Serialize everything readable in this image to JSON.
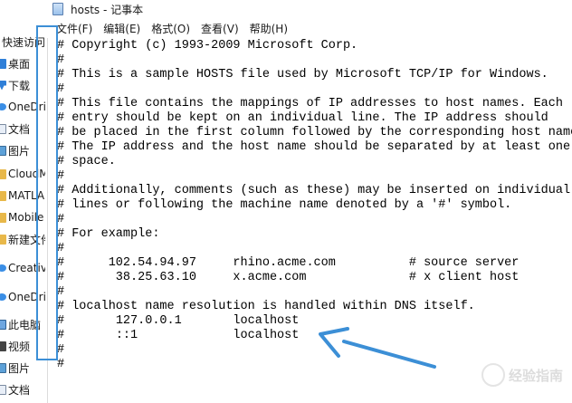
{
  "window": {
    "title": "hosts - 记事本"
  },
  "menu": [
    {
      "label": "文件(F)"
    },
    {
      "label": "编辑(E)"
    },
    {
      "label": "格式(O)"
    },
    {
      "label": "查看(V)"
    },
    {
      "label": "帮助(H)"
    }
  ],
  "sidebar": {
    "header": "快速访问",
    "items": [
      {
        "label": "桌面",
        "icon": "desktop-icon"
      },
      {
        "label": "下载",
        "icon": "download-icon"
      },
      {
        "label": "OneDrive",
        "icon": "cloud-icon"
      },
      {
        "label": "文档",
        "icon": "document-icon"
      },
      {
        "label": "图片",
        "icon": "picture-icon"
      },
      {
        "label": "CloudM",
        "icon": "folder-icon"
      },
      {
        "label": "MATLAB",
        "icon": "folder-icon"
      },
      {
        "label": "Mobile",
        "icon": "folder-icon"
      },
      {
        "label": "新建文件夹",
        "icon": "folder-icon"
      },
      {
        "label": "Creative Cloud",
        "icon": "cloud-icon"
      },
      {
        "label": "OneDrive",
        "icon": "cloud-icon"
      },
      {
        "label": "此电脑",
        "icon": "pc-icon"
      },
      {
        "label": "视频",
        "icon": "video-icon"
      },
      {
        "label": "图片",
        "icon": "picture-icon"
      },
      {
        "label": "文档",
        "icon": "document-icon"
      }
    ]
  },
  "editor": {
    "lines": [
      "# Copyright (c) 1993-2009 Microsoft Corp.",
      "#",
      "# This is a sample HOSTS file used by Microsoft TCP/IP for Windows.",
      "#",
      "# This file contains the mappings of IP addresses to host names. Each",
      "# entry should be kept on an individual line. The IP address should",
      "# be placed in the first column followed by the corresponding host name.",
      "# The IP address and the host name should be separated by at least one",
      "# space.",
      "#",
      "# Additionally, comments (such as these) may be inserted on individual",
      "# lines or following the machine name denoted by a '#' symbol.",
      "#",
      "# For example:",
      "#",
      "#      102.54.94.97     rhino.acme.com          # source server",
      "#       38.25.63.10     x.acme.com              # x client host",
      "#",
      "# localhost name resolution is handled within DNS itself.",
      "#\t127.0.0.1       localhost",
      "#\t::1             localhost",
      "#",
      "#"
    ]
  },
  "colors": {
    "annotation": "#3c8fd6"
  },
  "watermark": {
    "text": "经验指南"
  }
}
